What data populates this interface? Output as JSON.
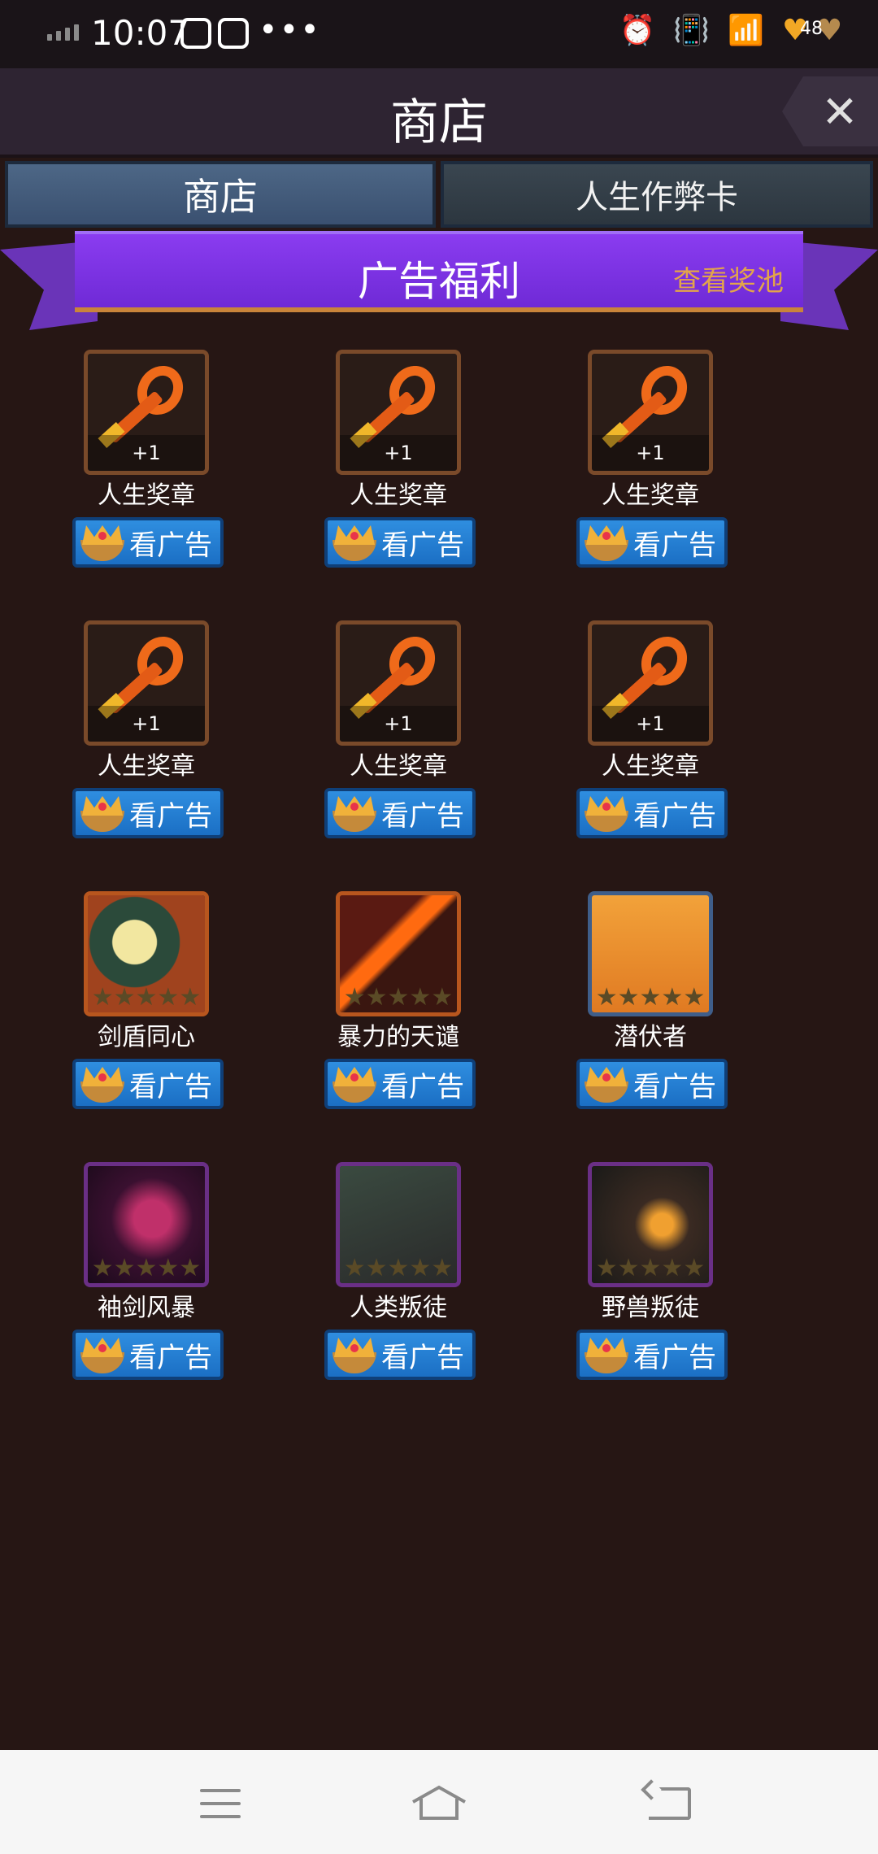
{
  "status_bar": {
    "time": "10:07",
    "more": "•••",
    "battery_level": "48",
    "icons": [
      "signal-icon",
      "media-icon",
      "gallery-icon",
      "alarm-icon",
      "vibrate-icon",
      "wifi-icon",
      "battery-icon"
    ]
  },
  "header": {
    "title": "商店",
    "close_symbol": "✕"
  },
  "tabs": [
    {
      "label": "商店",
      "active": true
    },
    {
      "label": "人生作弊卡",
      "active": false
    }
  ],
  "banner": {
    "title": "广告福利",
    "link": "查看奖池"
  },
  "items": [
    {
      "name": "人生奖章",
      "badge": "+1",
      "kind": "key",
      "button": "看广告"
    },
    {
      "name": "人生奖章",
      "badge": "+1",
      "kind": "key",
      "button": "看广告"
    },
    {
      "name": "人生奖章",
      "badge": "+1",
      "kind": "key",
      "button": "看广告"
    },
    {
      "name": "人生奖章",
      "badge": "+1",
      "kind": "key",
      "button": "看广告"
    },
    {
      "name": "人生奖章",
      "badge": "+1",
      "kind": "key",
      "button": "看广告"
    },
    {
      "name": "人生奖章",
      "badge": "+1",
      "kind": "key",
      "button": "看广告"
    },
    {
      "name": "剑盾同心",
      "kind": "card",
      "frame": "orange",
      "button": "看广告"
    },
    {
      "name": "暴力的天谴",
      "kind": "card",
      "frame": "orange",
      "button": "看广告"
    },
    {
      "name": "潜伏者",
      "kind": "card",
      "frame": "blue",
      "button": "看广告"
    },
    {
      "name": "袖剑风暴",
      "kind": "card",
      "frame": "purple",
      "button": "看广告"
    },
    {
      "name": "人类叛徒",
      "kind": "card",
      "frame": "purple",
      "button": "看广告"
    },
    {
      "name": "野兽叛徒",
      "kind": "card",
      "frame": "purple",
      "button": "看广告"
    }
  ],
  "colors": {
    "background": "#261614",
    "button_blue": "#1b6fc4",
    "banner_purple": "#7a30e0",
    "link_orange": "#e3a44a"
  },
  "nav": {
    "icons": [
      "menu-icon",
      "home-icon",
      "back-icon"
    ]
  }
}
